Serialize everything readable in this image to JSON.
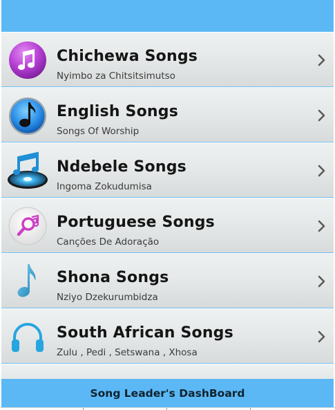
{
  "list": {
    "items": [
      {
        "title": "Chichewa Songs",
        "subtitle": "Nyimbo za Chitsitsimutso",
        "icon": "purple-music-note-icon"
      },
      {
        "title": "English Songs",
        "subtitle": "Songs Of Worship",
        "icon": "blue-music-note-icon"
      },
      {
        "title": "Ndebele Songs",
        "subtitle": "Ingoma Zokudumisa",
        "icon": "music-disc-icon"
      },
      {
        "title": "Portuguese Songs",
        "subtitle": "Canções De Adoração",
        "icon": "music-search-icon"
      },
      {
        "title": "Shona Songs",
        "subtitle": "Nziyo Dzekurumbidza",
        "icon": "blue-eighth-note-icon"
      },
      {
        "title": "South African Songs",
        "subtitle": "Zulu , Pedi , Setswana , Xhosa",
        "icon": "headphones-icon"
      }
    ]
  },
  "footer": {
    "dashboard_label": "Song Leader's DashBoard"
  },
  "colors": {
    "header_blue": "#5bb8f5",
    "divider_blue": "#6fbff0",
    "row_gray": "#e3e6e6"
  }
}
